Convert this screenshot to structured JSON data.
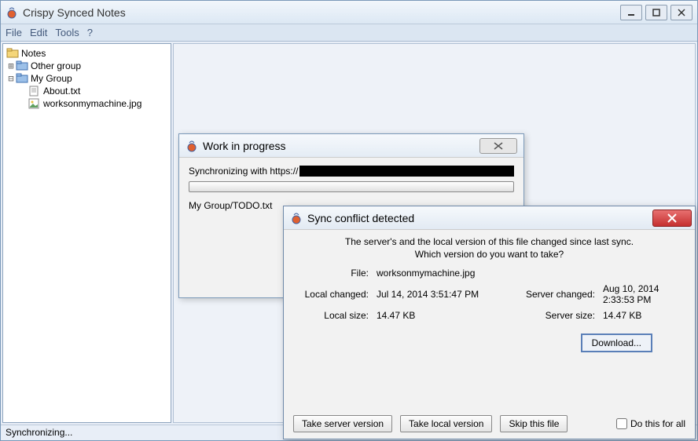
{
  "app": {
    "title": "Crispy Synced Notes",
    "menus": [
      "File",
      "Edit",
      "Tools",
      "?"
    ],
    "status": "Synchronizing..."
  },
  "tree": {
    "root": "Notes",
    "items": [
      {
        "label": "Other group",
        "type": "folder"
      },
      {
        "label": "My Group",
        "type": "folder"
      },
      {
        "label": "About.txt",
        "type": "file"
      },
      {
        "label": "worksonmymachine.jpg",
        "type": "image"
      }
    ]
  },
  "progress": {
    "title": "Work in progress",
    "sync_prefix": "Synchronizing with https://",
    "current_file": "My Group/TODO.txt"
  },
  "conflict": {
    "title": "Sync conflict detected",
    "msg1": "The server's and the local version of this file changed since last sync.",
    "msg2": "Which version do you want to take?",
    "labels": {
      "file": "File:",
      "local_changed": "Local changed:",
      "server_changed": "Server changed:",
      "local_size": "Local size:",
      "server_size": "Server size:"
    },
    "file": "worksonmymachine.jpg",
    "local_changed": "Jul 14, 2014 3:51:47 PM",
    "server_changed": "Aug 10, 2014 2:33:53 PM",
    "local_size": "14.47 KB",
    "server_size": "14.47 KB",
    "buttons": {
      "download": "Download...",
      "take_server": "Take server version",
      "take_local": "Take local version",
      "skip": "Skip this file",
      "do_all": "Do this for all"
    }
  }
}
